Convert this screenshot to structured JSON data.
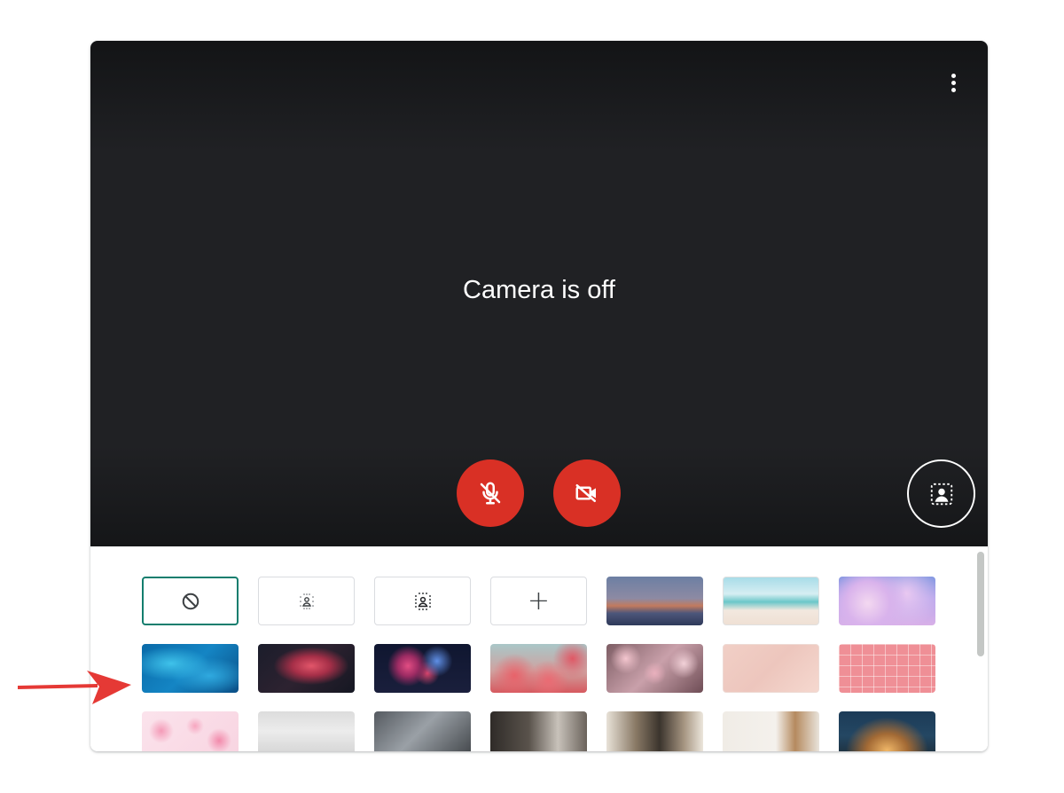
{
  "preview": {
    "message": "Camera is off",
    "more_icon": "more-vert-icon",
    "mic_icon": "mic-off-icon",
    "camera_icon": "videocam-off-icon",
    "effects_icon": "background-effects-icon",
    "mic_color": "#d93025",
    "camera_color": "#d93025"
  },
  "backgrounds": {
    "options": [
      {
        "name": "no-effect",
        "icon": "no-effect-icon",
        "selected": true
      },
      {
        "name": "slight-blur",
        "icon": "slight-blur-icon"
      },
      {
        "name": "blur",
        "icon": "blur-icon"
      },
      {
        "name": "add-image",
        "icon": "plus-icon",
        "label": "+"
      }
    ],
    "images": [
      {
        "name": "sunset-horizon"
      },
      {
        "name": "beach"
      },
      {
        "name": "pink-clouds"
      },
      {
        "name": "pool-water"
      },
      {
        "name": "nebula"
      },
      {
        "name": "fireworks"
      },
      {
        "name": "red-flowers"
      },
      {
        "name": "cherry-blossoms"
      },
      {
        "name": "pink-bokeh"
      },
      {
        "name": "pink-wall-pattern"
      },
      {
        "name": "confetti"
      },
      {
        "name": "white-room"
      },
      {
        "name": "glass-roof"
      },
      {
        "name": "dark-room"
      },
      {
        "name": "bookshelf-room"
      },
      {
        "name": "wall-shelves"
      },
      {
        "name": "night-cabin"
      }
    ]
  },
  "annotation": {
    "arrow_color": "#e53935",
    "arrow_icon": "red-arrow-icon"
  },
  "theme": {
    "selected_border": "#137e6e",
    "control_red": "#d93025",
    "preview_bg": "#202124"
  }
}
